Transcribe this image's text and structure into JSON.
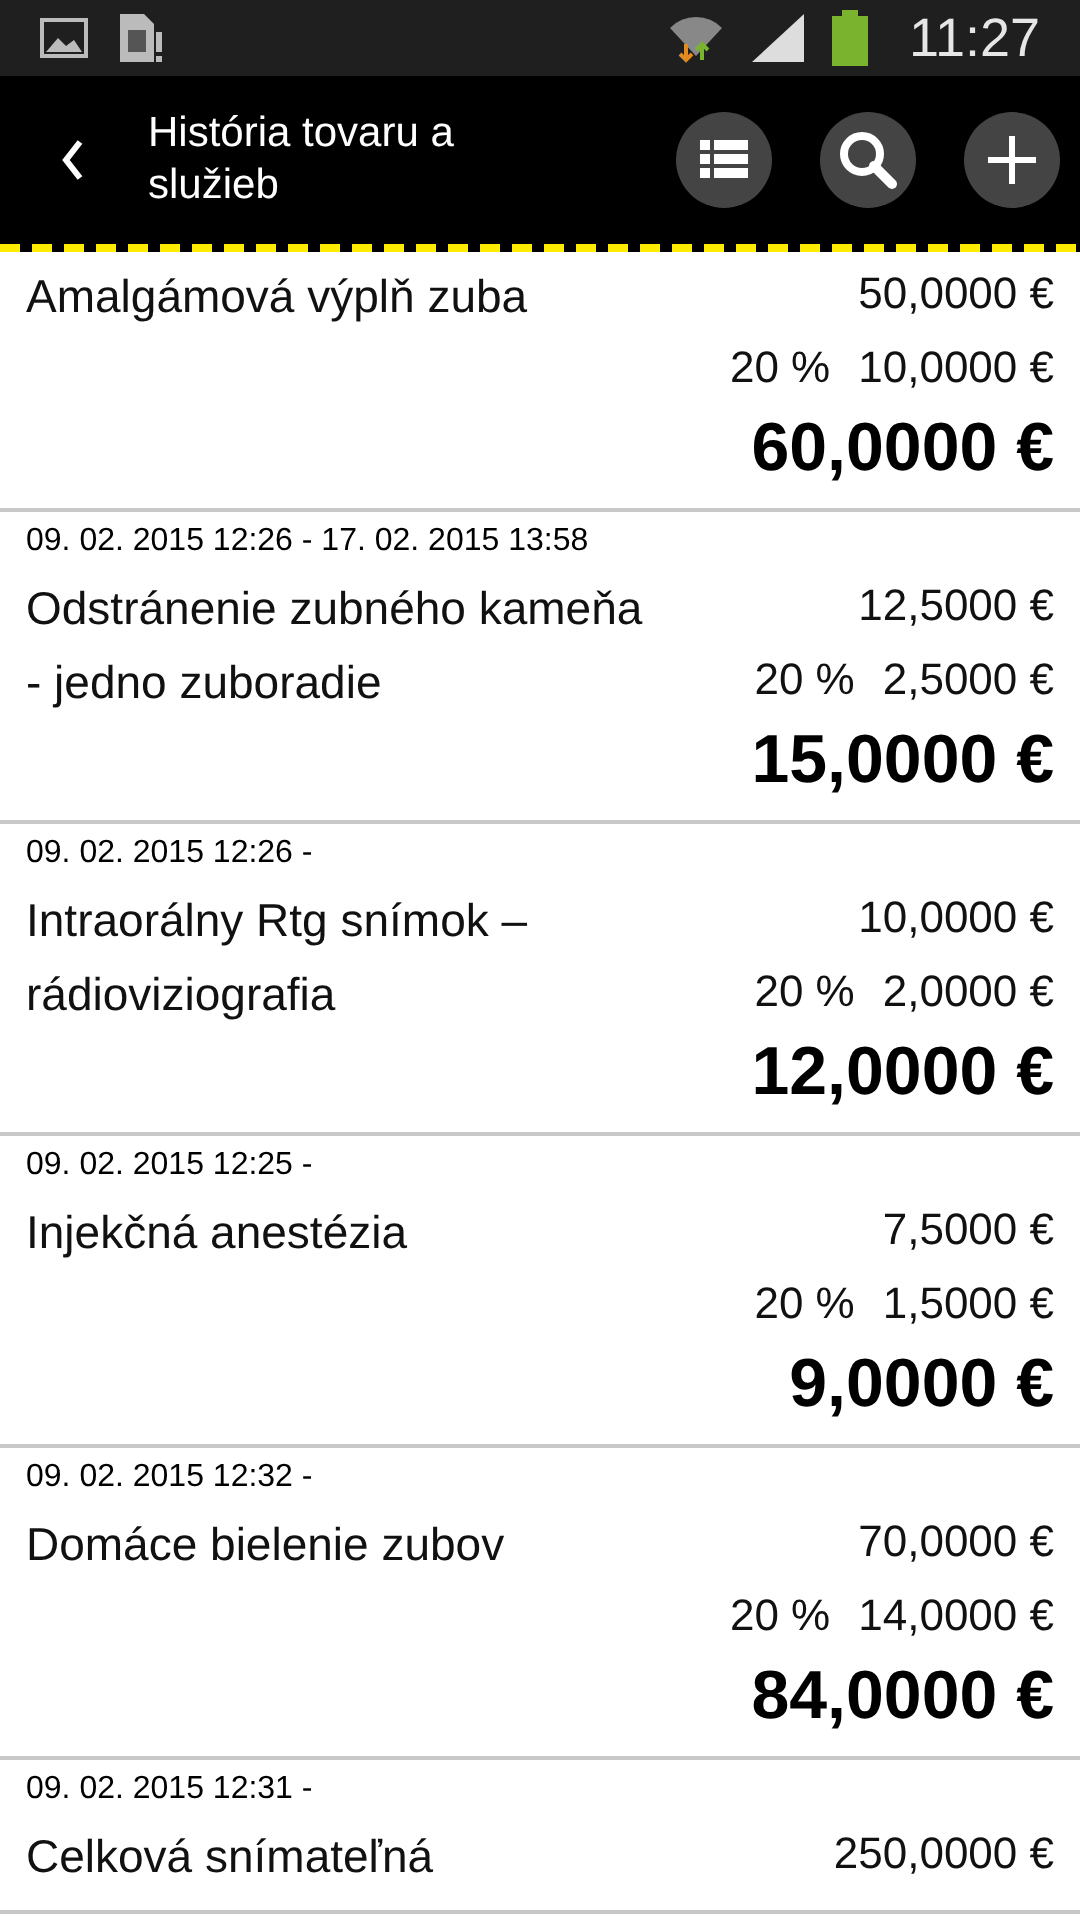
{
  "status_bar": {
    "time": "11:27"
  },
  "toolbar": {
    "title": "História tovaru a služieb"
  },
  "items": [
    {
      "name": "Amalgámová výplň zuba",
      "price": "50,0000 €",
      "vat_rate": "20 %",
      "vat": "10,0000 €",
      "total": "60,0000 €"
    },
    {
      "date": "09. 02. 2015 12:26 - 17. 02. 2015 13:58",
      "name": "Odstránenie zubného kameňa - jedno zuboradie",
      "price": "12,5000 €",
      "vat_rate": "20 %",
      "vat": "2,5000 €",
      "total": "15,0000 €"
    },
    {
      "date": "09. 02. 2015 12:26 -",
      "name": "Intraorálny Rtg snímok – rádioviziografia",
      "price": "10,0000 €",
      "vat_rate": "20 %",
      "vat": "2,0000 €",
      "total": "12,0000 €"
    },
    {
      "date": "09. 02. 2015 12:25 -",
      "name": "Injekčná anestézia",
      "price": "7,5000 €",
      "vat_rate": "20 %",
      "vat": "1,5000 €",
      "total": "9,0000 €"
    },
    {
      "date": "09. 02. 2015 12:32 -",
      "name": "Domáce bielenie zubov",
      "price": "70,0000 €",
      "vat_rate": "20 %",
      "vat": "14,0000 €",
      "total": "84,0000 €"
    },
    {
      "date": "09. 02. 2015 12:31 -",
      "name": "Celková snímateľná",
      "price": "250,0000 €"
    }
  ]
}
